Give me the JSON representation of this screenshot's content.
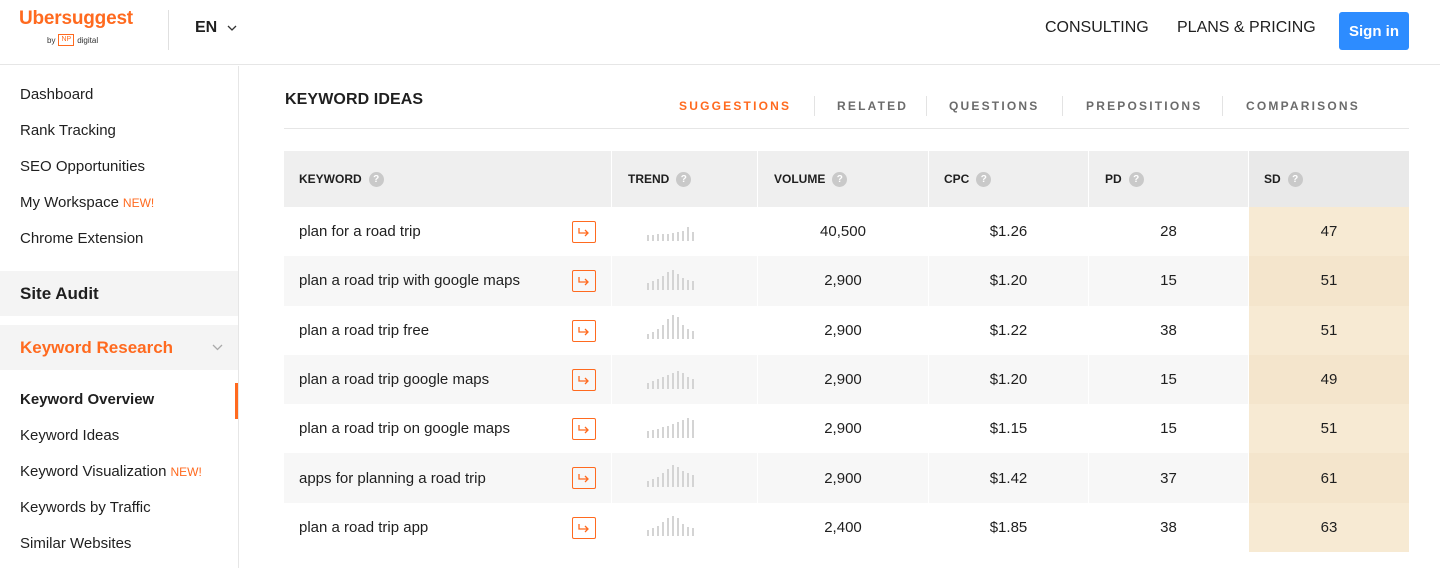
{
  "header": {
    "logo": "Ubersuggest",
    "logo_by": "by",
    "logo_np": "NP",
    "logo_digital": "digital",
    "language": "EN",
    "nav": {
      "consulting": "CONSULTING",
      "plans": "PLANS & PRICING"
    },
    "signin": "Sign in"
  },
  "sidebar": {
    "items_top": [
      {
        "label": "Dashboard"
      },
      {
        "label": "Rank Tracking"
      },
      {
        "label": "SEO Opportunities"
      },
      {
        "label": "My Workspace",
        "badge": "NEW!"
      },
      {
        "label": "Chrome Extension"
      }
    ],
    "site_audit": "Site Audit",
    "keyword_research": "Keyword Research",
    "items_kr": [
      {
        "label": "Keyword Overview"
      },
      {
        "label": "Keyword Ideas"
      },
      {
        "label": "Keyword Visualization",
        "badge": "NEW!"
      },
      {
        "label": "Keywords by Traffic"
      },
      {
        "label": "Similar Websites"
      }
    ]
  },
  "main": {
    "title": "KEYWORD IDEAS",
    "tabs": [
      "SUGGESTIONS",
      "RELATED",
      "QUESTIONS",
      "PREPOSITIONS",
      "COMPARISONS"
    ],
    "active_tab": "SUGGESTIONS"
  },
  "table": {
    "columns": [
      "KEYWORD",
      "TREND",
      "VOLUME",
      "CPC",
      "PD",
      "SD"
    ],
    "rows": [
      {
        "keyword": "plan for a road trip",
        "volume": "40,500",
        "cpc": "$1.26",
        "pd": "28",
        "sd": "47",
        "trend": [
          6,
          6,
          7,
          7,
          7,
          8,
          9,
          10,
          14,
          9
        ]
      },
      {
        "keyword": "plan a road trip with google maps",
        "volume": "2,900",
        "cpc": "$1.20",
        "pd": "15",
        "sd": "51",
        "trend": [
          7,
          9,
          11,
          14,
          18,
          20,
          16,
          12,
          10,
          9
        ]
      },
      {
        "keyword": "plan a road trip free",
        "volume": "2,900",
        "cpc": "$1.22",
        "pd": "38",
        "sd": "51",
        "trend": [
          5,
          7,
          10,
          14,
          20,
          24,
          22,
          14,
          10,
          8
        ]
      },
      {
        "keyword": "plan a road trip google maps",
        "volume": "2,900",
        "cpc": "$1.20",
        "pd": "15",
        "sd": "49",
        "trend": [
          6,
          8,
          10,
          12,
          14,
          16,
          18,
          16,
          12,
          10
        ]
      },
      {
        "keyword": "plan a road trip on google maps",
        "volume": "2,900",
        "cpc": "$1.15",
        "pd": "15",
        "sd": "51",
        "trend": [
          7,
          8,
          9,
          11,
          12,
          14,
          16,
          18,
          20,
          18
        ]
      },
      {
        "keyword": "apps for planning a road trip",
        "volume": "2,900",
        "cpc": "$1.42",
        "pd": "37",
        "sd": "61",
        "trend": [
          6,
          8,
          10,
          14,
          18,
          22,
          20,
          16,
          14,
          12
        ]
      },
      {
        "keyword": "plan a road trip app",
        "volume": "2,400",
        "cpc": "$1.85",
        "pd": "38",
        "sd": "63",
        "trend": [
          6,
          8,
          10,
          14,
          18,
          20,
          18,
          12,
          9,
          8
        ]
      }
    ]
  }
}
